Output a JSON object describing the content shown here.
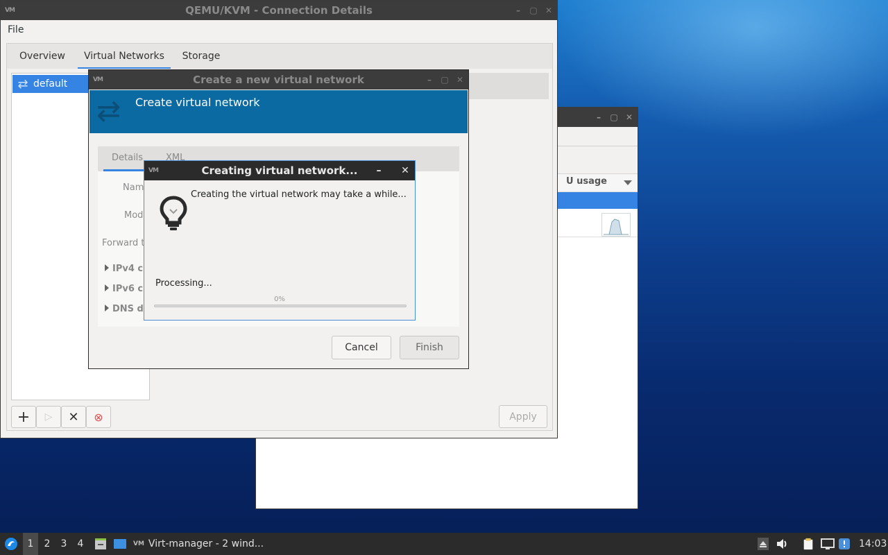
{
  "desktop": {},
  "back_window": {
    "column_header": "U usage",
    "controls": [
      "–",
      "▢",
      "✕"
    ]
  },
  "main_window": {
    "title": "QEMU/KVM - Connection Details",
    "logo": "VM",
    "controls": [
      "–",
      "▢",
      "✕"
    ],
    "menu": {
      "file": "File"
    },
    "tabs": [
      {
        "label": "Overview"
      },
      {
        "label": "Virtual Networks"
      },
      {
        "label": "Storage"
      }
    ],
    "networks": [
      {
        "name": "default",
        "icon": "network-arrows-icon"
      }
    ],
    "buttons": {
      "add": "+",
      "start": "▷",
      "delete": "✕",
      "stop": "⊗",
      "apply": "Apply"
    }
  },
  "create_dialog": {
    "title": "Create a new virtual network",
    "logo": "VM",
    "controls": [
      "–",
      "▢",
      "✕"
    ],
    "banner": "Create virtual network",
    "tabs": [
      {
        "label": "Details"
      },
      {
        "label": "XML"
      }
    ],
    "labels": {
      "name": "Nam",
      "mode": "Mod",
      "forward": "Forward t"
    },
    "expanders": [
      {
        "label": "IPv4 c"
      },
      {
        "label": "IPv6 c"
      },
      {
        "label": "DNS d"
      }
    ],
    "buttons": {
      "cancel": "Cancel",
      "finish": "Finish"
    }
  },
  "progress_dialog": {
    "title": "Creating virtual network...",
    "logo": "VM",
    "controls": [
      "–",
      "✕"
    ],
    "message": "Creating the virtual network may take a while...",
    "status": "Processing...",
    "percent_label": "0%",
    "progress_value": 0
  },
  "taskbar": {
    "workspaces": [
      "1",
      "2",
      "3",
      "4"
    ],
    "active_workspace": "1",
    "task_label": "Virt-manager - 2 wind...",
    "task_logo": "VM",
    "clock": "14:03"
  }
}
